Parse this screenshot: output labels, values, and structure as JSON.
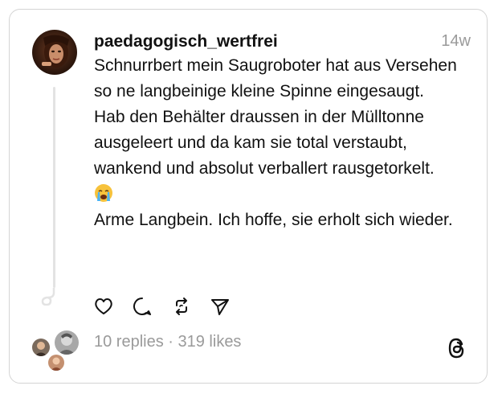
{
  "post": {
    "username": "paedagogisch_wertfrei",
    "time": "14w",
    "paragraphs": [
      "Schnurrbert mein Saugroboter hat aus Versehen so ne langbeinige kleine Spinne eingesaugt.",
      "Hab den Behälter draussen in der Mülltonne ausgeleert und da kam sie total verstaubt, wankend und absolut verballert rausgetorkelt.",
      "Arme Langbein. Ich hoffe, sie erholt sich wieder."
    ],
    "emoji_icon": "loudly-crying-face-emoji"
  },
  "actions": [
    "heart-icon",
    "comment-icon",
    "repost-icon",
    "share-icon"
  ],
  "stats": {
    "replies": "10 replies",
    "separator": " · ",
    "likes": "319 likes"
  },
  "brand": "threads-logo-icon",
  "colors": {
    "text": "#111111",
    "muted": "#9a9a9a",
    "border": "#d4d4d4",
    "thread_line": "#e3e3e3"
  }
}
